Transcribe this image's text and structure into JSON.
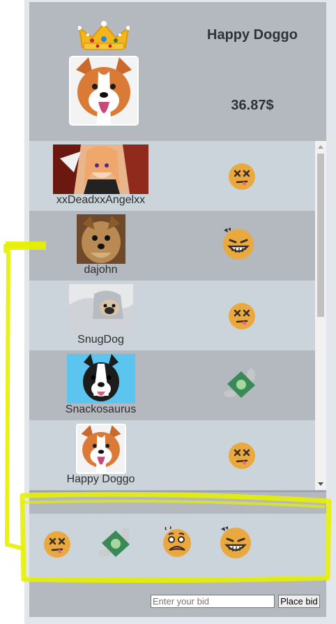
{
  "auction": {
    "title": "Happy Doggo",
    "price": "36.87$"
  },
  "bidders": [
    {
      "name": "xxDeadxxAngelxx",
      "avatar": "anime-girl-avatar",
      "reaction": "dead-face-emoji"
    },
    {
      "name": "dajohn",
      "avatar": "yorkie-dog-avatar",
      "reaction": "grinning-angry-emoji"
    },
    {
      "name": "SnugDog",
      "avatar": "pug-in-blanket-avatar",
      "reaction": "dead-face-emoji"
    },
    {
      "name": "Snackosaurus",
      "avatar": "boston-terrier-avatar",
      "reaction": "money-bill-emoji"
    },
    {
      "name": "Happy Doggo",
      "avatar": "corgi-avatar",
      "reaction": "dead-face-emoji"
    }
  ],
  "reactions": [
    "dead-face-emoji",
    "money-bill-emoji",
    "scared-face-emoji",
    "grinning-angry-emoji"
  ],
  "bid": {
    "placeholder": "Enter your bid",
    "button_label": "Place bid"
  },
  "colors": {
    "panel": "#b4b9c0",
    "row_light": "#ccd4db",
    "highlight": "#e5ef00",
    "emoji": "#e8a83d"
  }
}
